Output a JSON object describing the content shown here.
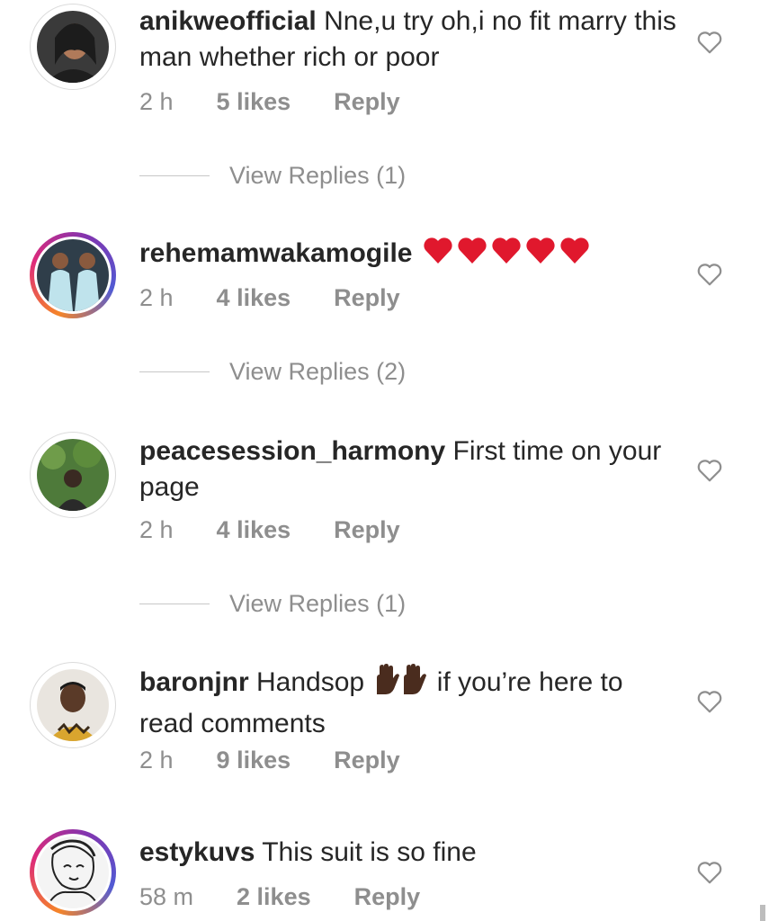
{
  "comments": [
    {
      "username": "anikweofficial",
      "text": "Nne,u try oh,i no fit marry this man whether rich or poor",
      "time": "2 h",
      "likes": "5 likes",
      "reply": "Reply",
      "view_replies": "View Replies (1)",
      "avatar_ring": false
    },
    {
      "username": "rehemamwakamogile",
      "text": "",
      "emoji": "red-heart x5",
      "time": "2 h",
      "likes": "4 likes",
      "reply": "Reply",
      "view_replies": "View Replies (2)",
      "avatar_ring": true
    },
    {
      "username": "peacesession_harmony",
      "text": "First time on your page",
      "time": "2 h",
      "likes": "4 likes",
      "reply": "Reply",
      "view_replies": "View Replies (1)",
      "avatar_ring": false
    },
    {
      "username": "baronjnr",
      "text_before": "Handsop",
      "text_after": "if you’re here to read comments",
      "emoji": "raised-hand x2",
      "time": "2 h",
      "likes": "9 likes",
      "reply": "Reply",
      "avatar_ring": false
    },
    {
      "username": "estykuvs",
      "text": "This suit is so fine",
      "time": "58 m",
      "likes": "2 likes",
      "reply": "Reply",
      "avatar_ring": true
    }
  ],
  "icons": {
    "like": "heart-outline-icon"
  },
  "colors": {
    "text": "#262626",
    "muted": "#8e8e8e",
    "heart_emoji": "#e0182d"
  }
}
